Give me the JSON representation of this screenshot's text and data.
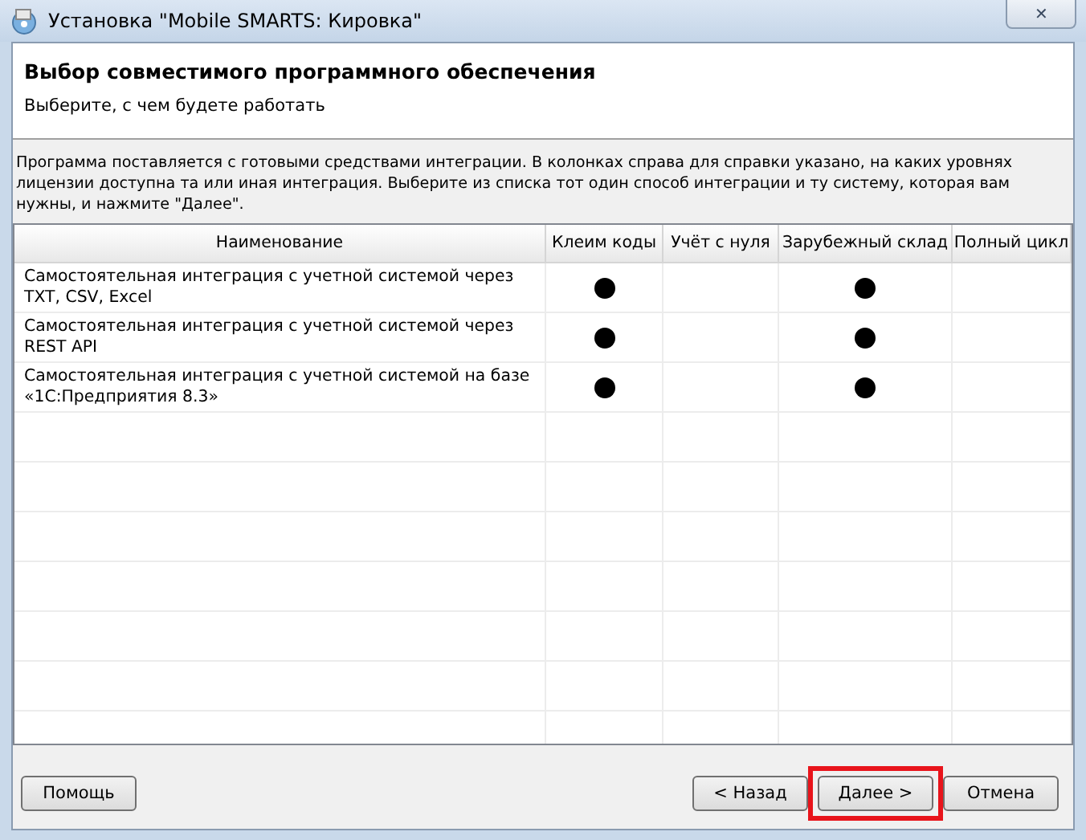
{
  "window": {
    "title": "Установка \"Mobile SMARTS: Кировка\"",
    "close": "✕"
  },
  "header": {
    "title": "Выбор совместимого программного обеспечения",
    "subtitle": "Выберите, с чем будете работать"
  },
  "description": "Программа поставляется с готовыми средствами интеграции. В колонках справа для справки указано, на каких уровнях лицензии доступна та или иная интеграция. Выберите из списка тот один способ интеграции и ту систему, которая вам нужны, и нажмите \"Далее\".",
  "table": {
    "columns": [
      "Наименование",
      "Клеим коды",
      "Учёт с нуля",
      "Зарубежный склад",
      "Полный цикл"
    ],
    "rows": [
      {
        "name": "Самостоятельная интеграция с учетной системой через TXT, CSV, Excel",
        "cells": [
          {
            "marked": true
          },
          {
            "marked": false
          },
          {
            "marked": true
          },
          {
            "marked": false
          }
        ]
      },
      {
        "name": "Самостоятельная интеграция с учетной системой через REST API",
        "cells": [
          {
            "marked": true
          },
          {
            "marked": false
          },
          {
            "marked": true
          },
          {
            "marked": false
          }
        ]
      },
      {
        "name": "Самостоятельная интеграция с учетной системой на базе «1С:Предприятия 8.3»",
        "cells": [
          {
            "marked": true
          },
          {
            "marked": false
          },
          {
            "marked": true
          },
          {
            "marked": false
          }
        ]
      }
    ]
  },
  "buttons": [
    {
      "label": "Помощь",
      "kind": "left",
      "highlighted": false
    },
    {
      "label": "< Назад",
      "kind": "right",
      "highlighted": false
    },
    {
      "label": "Далее >",
      "kind": "right",
      "highlighted": true
    },
    {
      "label": "Отмена",
      "kind": "right",
      "highlighted": false
    }
  ]
}
